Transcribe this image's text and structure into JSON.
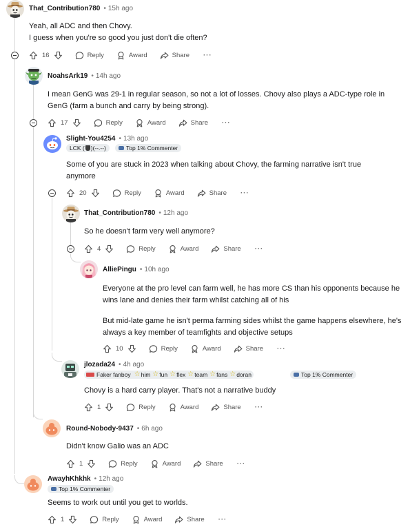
{
  "labels": {
    "reply": "Reply",
    "award": "Award",
    "share": "Share",
    "more": "···"
  },
  "comments": [
    {
      "username": "That_Contribution780",
      "time": "15h ago",
      "body": [
        "Yeah, all ADC and then Chovy.",
        "I guess when you're so good you just don't die often?"
      ],
      "votes": "16"
    },
    {
      "username": "NoahsArk19",
      "time": "14h ago",
      "body": [
        "I mean GenG was 29-1 in regular season, so not a lot of losses. Chovy also plays a ADC-type role in GenG (farm a bunch and carry by being strong)."
      ],
      "votes": "17"
    },
    {
      "username": "Slight-You4254",
      "time": "13h ago",
      "flair_lck": "LCK (",
      "flair_lck_end": ")(--.--)",
      "flair_top": "Top 1% Commenter",
      "body": [
        "Some of you are stuck in 2023 when talking about Chovy, the farming narrative isn't true anymore"
      ],
      "votes": "20"
    },
    {
      "username": "That_Contribution780",
      "time": "12h ago",
      "body": [
        "So he doesn't farm very well anymore?"
      ],
      "votes": "4"
    },
    {
      "username": "AlliePingu",
      "time": "10h ago",
      "body": [
        "Everyone at the pro level can farm well, he has more CS than his opponents because he wins lane and denies their farm whilst catching all of his",
        "But mid-late game he isn't perma farming sides whilst the game happens elsewhere, he's always a key member of teamfights and objective setups"
      ],
      "votes": "10"
    },
    {
      "username": "jlozada24",
      "time": "4h ago",
      "flair_fan": "Faker fanboy",
      "flair_stars": [
        "him",
        "fun",
        "flex",
        "team",
        "fans",
        "doran"
      ],
      "flair_top": "Top 1% Commenter",
      "body": [
        "Chovy is a hard carry player. That's not a narrative buddy"
      ],
      "votes": "1"
    },
    {
      "username": "Round-Nobody-9437",
      "time": "6h ago",
      "body": [
        "Didn't know Galio was an ADC"
      ],
      "votes": "1"
    },
    {
      "username": "AwayhKhkhk",
      "time": "12h ago",
      "flair_top": "Top 1% Commenter",
      "body": [
        "Seems to work out until you get to worlds."
      ],
      "votes": "1"
    }
  ],
  "colors": {
    "reddit_orange": "#f08a5d",
    "snoo_blue": "#6b8cff",
    "flair_bg": "#eaedef",
    "thread_line": "#d7d7d7"
  }
}
